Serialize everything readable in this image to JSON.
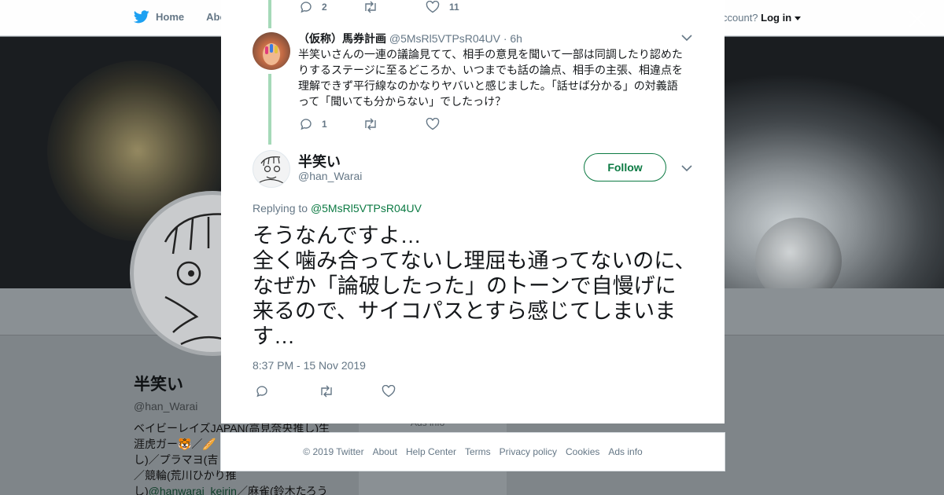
{
  "background": {
    "nav": {
      "home": "Home",
      "about": "Abo"
    },
    "account": {
      "prompt": "ccount?",
      "login": "Log in"
    },
    "profile": {
      "name": "半笑い",
      "handle": "@han_Warai",
      "bio_lines": [
        "ベイビーレイズJAPAN(高見奈央推し)生",
        "涯虎ガー🐯／🥖",
        "し)／プラマヨ(吉",
        "／競輪(荒川ひかり推"
      ],
      "bio_link_prefix": "し)",
      "bio_link": "@hanwarai_keirin",
      "bio_link_suffix": "／麻雀(鈴木たろう"
    },
    "card_label": "Ads info"
  },
  "thread": {
    "prev_actions": {
      "replies": "2",
      "retweets": "",
      "likes": "11"
    },
    "reply": {
      "name": "（仮称）馬券計画",
      "handle": "@5MsRl5VTPsR04UV",
      "time": "6h",
      "text": "半笑いさんの一連の議論見てて、相手の意見を聞いて一部は同調したり認めたりするステージに至るどころか、いつまでも話の論点、相手の主張、相違点を理解できず平行線なのかなりヤバいと感じました。「話せば分かる」の対義語って「聞いても分からない」でしたっけ？",
      "actions": {
        "replies": "1",
        "retweets": "",
        "likes": ""
      }
    },
    "main": {
      "name": "半笑い",
      "handle": "@han_Warai",
      "follow_label": "Follow",
      "replying_prefix": "Replying to",
      "replying_to": "@5MsRl5VTPsR04UV",
      "text": "そうなんですよ…\n全く噛み合ってないし理屈も通ってないのに、なぜか「論破したった」のトーンで自慢げに来るので、サイコパスとすら感じてしまいます…",
      "timestamp": "8:37 PM - 15 Nov 2019"
    }
  },
  "footer": {
    "copyright": "© 2019 Twitter",
    "links": [
      "About",
      "Help Center",
      "Terms",
      "Privacy policy",
      "Cookies",
      "Ads info"
    ]
  },
  "colors": {
    "accent": "#0c7a43",
    "thread_line": "#a5d9b8",
    "muted": "#657786",
    "twitter_blue": "#1da1f2"
  },
  "icons": [
    "twitter-bird-icon",
    "close-icon",
    "reply-icon",
    "retweet-icon",
    "like-icon",
    "chevron-down-icon"
  ]
}
